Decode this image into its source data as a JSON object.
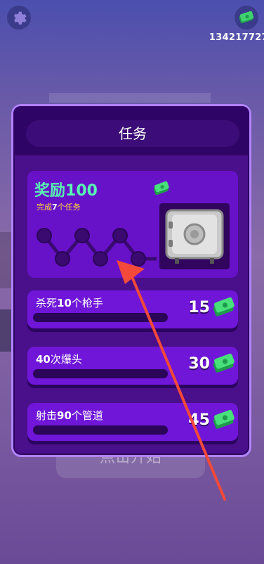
{
  "hud": {
    "settings_icon": "gear-icon",
    "cash_icon": "cash-icon",
    "cash_count": "134217727"
  },
  "background": {
    "start_label": "点击开始"
  },
  "panel": {
    "title": "任务",
    "reward": {
      "label": "奖励",
      "amount": "100",
      "sub_prefix": "完成",
      "sub_count": "7",
      "sub_suffix": "个任务",
      "progress_nodes": 7,
      "completed_nodes": 0
    },
    "tasks": [
      {
        "prefix": "杀死",
        "count": "10",
        "suffix": "个枪手",
        "reward": "15",
        "progress": 0
      },
      {
        "prefix": "",
        "count": "40",
        "suffix": "次爆头",
        "reward": "30",
        "progress": 0
      },
      {
        "prefix": "射击",
        "count": "90",
        "suffix": "个管道",
        "reward": "45",
        "progress": 0
      }
    ]
  },
  "colors": {
    "panel_bg": "#4a0f8a",
    "reward_green": "#59f3b4",
    "accent_yellow": "#ffd83a",
    "arrow_red": "#f2493a"
  }
}
